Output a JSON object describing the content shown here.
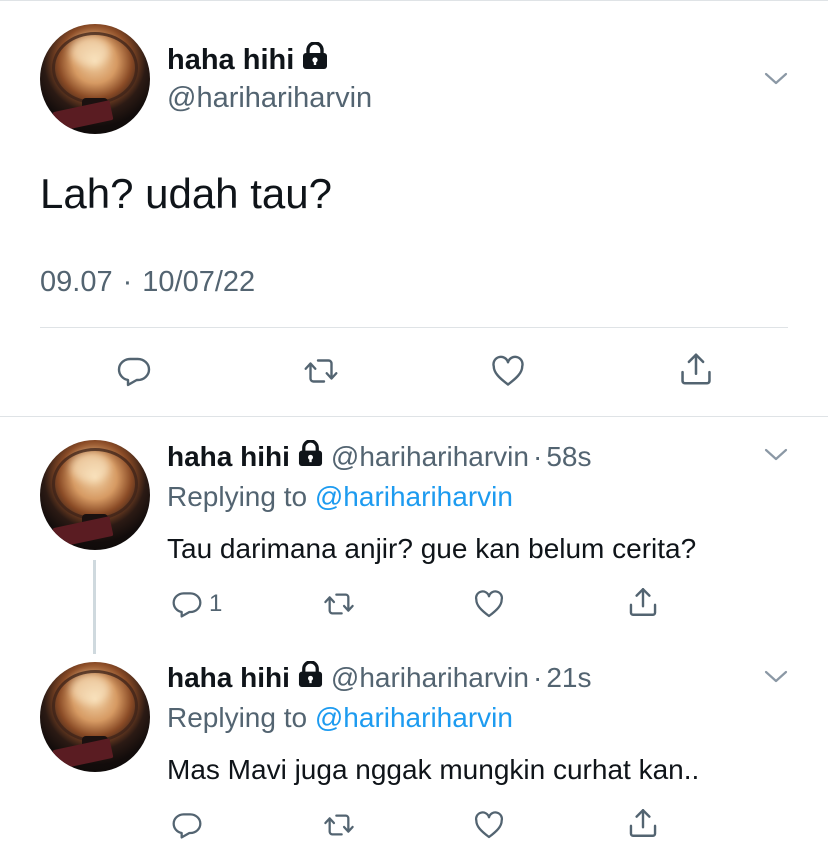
{
  "main_tweet": {
    "name": "haha hihi",
    "handle": "@harihariharvin",
    "text": "Lah? udah tau?",
    "time": "09.07",
    "separator": "·",
    "date": "10/07/22"
  },
  "replies": [
    {
      "name": "haha hihi",
      "handle": "@harihariharvin",
      "separator": "·",
      "time": "58s",
      "replying_prefix": "Replying to",
      "replying_mention": "@harihariharvin",
      "text": "Tau darimana anjir? gue kan belum cerita?",
      "reply_count": "1"
    },
    {
      "name": "haha hihi",
      "handle": "@harihariharvin",
      "separator": "·",
      "time": "21s",
      "replying_prefix": "Replying to",
      "replying_mention": "@harihariharvin",
      "text": "Mas Mavi juga nggak mungkin curhat kan..",
      "reply_count": ""
    }
  ],
  "icons": {
    "lock": "lock-icon",
    "chevron": "chevron-down-icon",
    "reply": "reply-icon",
    "retweet": "retweet-icon",
    "like": "like-icon",
    "share": "share-icon"
  },
  "colors": {
    "text": "#0f1419",
    "secondary": "#536471",
    "link": "#1d9bf0",
    "divider": "#dfe3e6"
  }
}
